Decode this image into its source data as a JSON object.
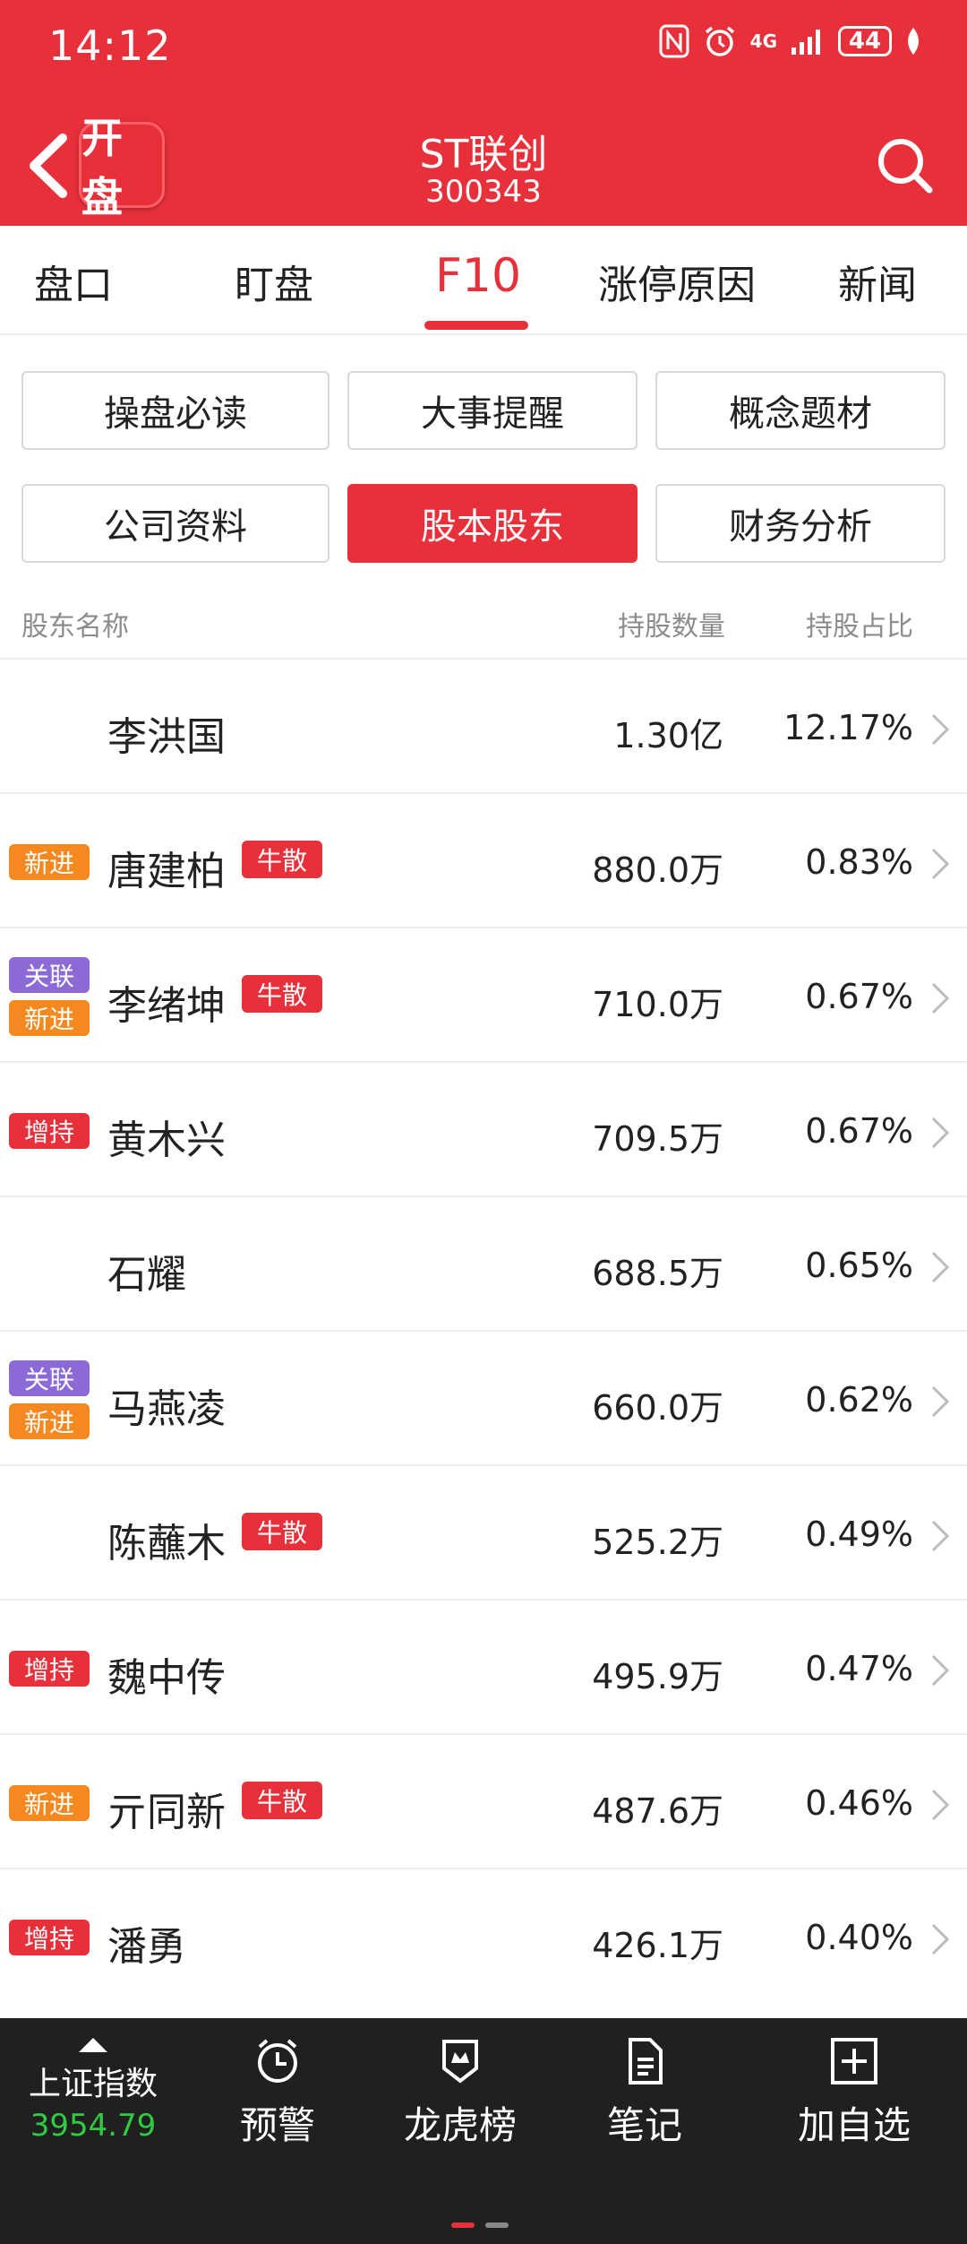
{
  "status": {
    "time": "14:12",
    "network": "4G",
    "battery": "44"
  },
  "header": {
    "logo": "开盘",
    "stock_name": "ST联创",
    "stock_code": "300343"
  },
  "tabs": [
    "盘口",
    "盯盘",
    "F10",
    "涨停原因",
    "新闻"
  ],
  "active_tab": "F10",
  "sub_buttons": [
    "操盘必读",
    "大事提醒",
    "概念题材",
    "公司资料",
    "股本股东",
    "财务分析"
  ],
  "active_sub_button": "股本股东",
  "columns": {
    "name": "股东名称",
    "shares": "持股数量",
    "ratio": "持股占比"
  },
  "rows": [
    {
      "name": "李洪国",
      "shares": "1.30亿",
      "ratio": "12.17%",
      "tags": [],
      "badge": ""
    },
    {
      "name": "唐建柏",
      "shares": "880.0万",
      "ratio": "0.83%",
      "tags": [
        "新进"
      ],
      "badge": "牛散"
    },
    {
      "name": "李绪坤",
      "shares": "710.0万",
      "ratio": "0.67%",
      "tags": [
        "关联",
        "新进"
      ],
      "badge": "牛散"
    },
    {
      "name": "黄木兴",
      "shares": "709.5万",
      "ratio": "0.67%",
      "tags": [
        "增持"
      ],
      "badge": ""
    },
    {
      "name": "石耀",
      "shares": "688.5万",
      "ratio": "0.65%",
      "tags": [],
      "badge": ""
    },
    {
      "name": "马燕凌",
      "shares": "660.0万",
      "ratio": "0.62%",
      "tags": [
        "关联",
        "新进"
      ],
      "badge": ""
    },
    {
      "name": "陈蘸木",
      "shares": "525.2万",
      "ratio": "0.49%",
      "tags": [],
      "badge": "牛散"
    },
    {
      "name": "魏中传",
      "shares": "495.9万",
      "ratio": "0.47%",
      "tags": [
        "增持"
      ],
      "badge": ""
    },
    {
      "name": "亓同新",
      "shares": "487.6万",
      "ratio": "0.46%",
      "tags": [
        "新进"
      ],
      "badge": "牛散"
    },
    {
      "name": "潘勇",
      "shares": "426.1万",
      "ratio": "0.40%",
      "tags": [
        "增持"
      ],
      "badge": ""
    }
  ],
  "bottom_bar": {
    "index_name": "上证指数",
    "index_value": "3954.79",
    "items": [
      "预警",
      "龙虎榜",
      "笔记",
      "加自选"
    ]
  },
  "colors": {
    "brand_red": "#e8303a",
    "tag_orange": "#f5891f",
    "tag_purple": "#8b6ad6",
    "index_green": "#2ecc40"
  }
}
